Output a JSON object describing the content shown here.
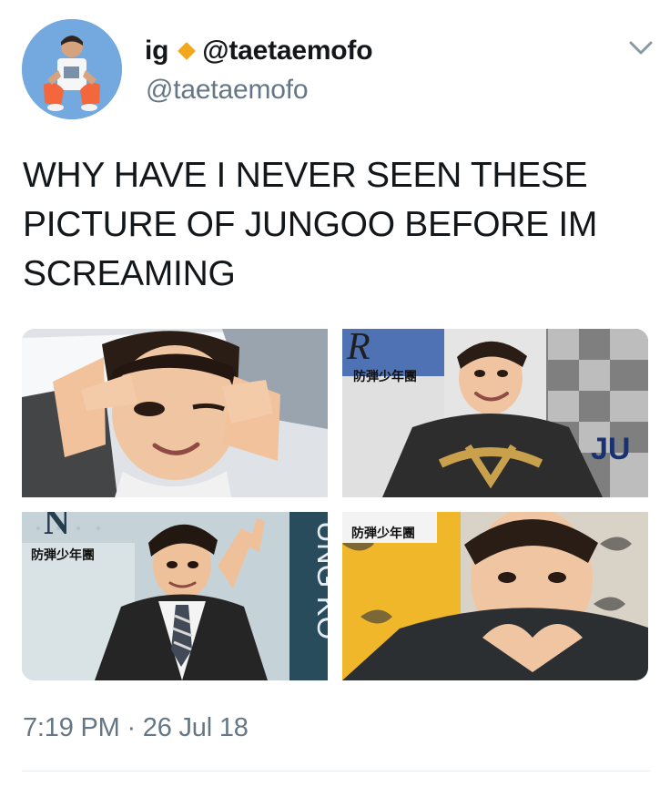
{
  "user": {
    "display_name": "ig",
    "display_name_suffix": "@taetaemofo",
    "handle": "@taetaemofo"
  },
  "tweet": {
    "text": "WHY HAVE I NEVER SEEN THESE\nPICTURE OF JUNGOO BEFORE IM\nSCREAMING",
    "timestamp": "7:19 PM · 26 Jul 18"
  },
  "media": {
    "images": [
      {
        "alt": "Jungkook making peace signs and winking"
      },
      {
        "alt": "Jungkook smiling in black ornate shirt"
      },
      {
        "alt": "Jungkook in suit and tie making a V sign"
      },
      {
        "alt": "Jungkook smiling with heart hands"
      }
    ],
    "tile_labels": [
      "防弾少年團",
      "防弾少年團",
      "防弾少年團"
    ],
    "tile_letters": [
      "R",
      "JU",
      "N",
      "UNG KO"
    ]
  },
  "colors": {
    "text": "#14171a",
    "secondary": "#657786",
    "verified_diamond": "#f2a71d",
    "divider": "#e6ecf0"
  },
  "icons": {
    "more": "chevron-down-icon",
    "verified": "diamond-icon"
  }
}
